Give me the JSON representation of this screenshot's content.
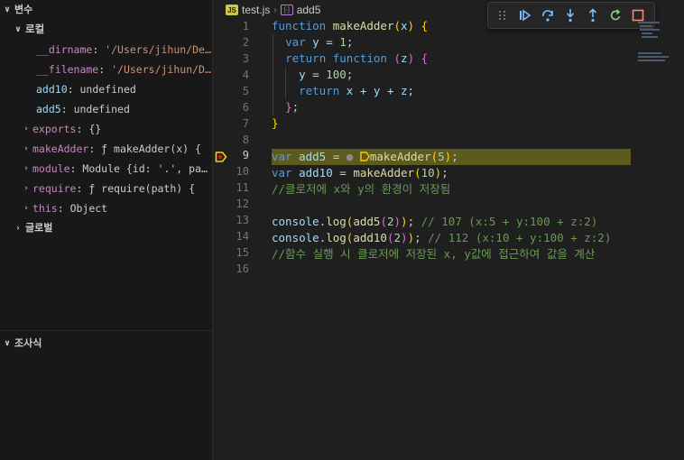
{
  "sidebar": {
    "variables_title": "변수",
    "local_title": "로컬",
    "global_title": "글로벌",
    "watch_title": "조사식",
    "vars": [
      {
        "name": "__dirname",
        "sep": ": ",
        "value": "'/Users/jihun/De…",
        "kind": "str",
        "expandable": false
      },
      {
        "name": "__filename",
        "sep": ": ",
        "value": "'/Users/jihun/D…",
        "kind": "str",
        "expandable": false
      },
      {
        "name": "add10",
        "sep": ": ",
        "value": "undefined",
        "kind": "gray",
        "expandable": false
      },
      {
        "name": "add5",
        "sep": ": ",
        "value": "undefined",
        "kind": "gray",
        "expandable": false
      },
      {
        "name": "exports",
        "sep": ": ",
        "value": "{}",
        "kind": "gray",
        "expandable": true
      },
      {
        "name": "makeAdder",
        "sep": ": ",
        "value": "ƒ makeAdder(x) {",
        "kind": "gray",
        "expandable": true
      },
      {
        "name": "module",
        "sep": ": ",
        "value": "Module {id: '.', pa…",
        "kind": "gray",
        "expandable": true
      },
      {
        "name": "require",
        "sep": ": ",
        "value": "ƒ require(path) {",
        "kind": "gray",
        "expandable": true
      },
      {
        "name": "this",
        "sep": ": ",
        "value": "Object",
        "kind": "gray",
        "expandable": true
      }
    ]
  },
  "breadcrumb": {
    "file": "test.js",
    "symbol": "add5",
    "badge": "JS"
  },
  "editor": {
    "current_line": 9,
    "lines": [
      {
        "n": "1"
      },
      {
        "n": "2"
      },
      {
        "n": "3"
      },
      {
        "n": "4"
      },
      {
        "n": "5"
      },
      {
        "n": "6"
      },
      {
        "n": "7"
      },
      {
        "n": "8"
      },
      {
        "n": "9"
      },
      {
        "n": "10"
      },
      {
        "n": "11"
      },
      {
        "n": "12"
      },
      {
        "n": "13"
      },
      {
        "n": "14"
      },
      {
        "n": "15"
      },
      {
        "n": "16"
      }
    ],
    "tokens": {
      "l1_kw": "function",
      "l1_fn": "makeAdder",
      "l1_rest": "x",
      "l2": "  var y = 1;",
      "l3_kw1": "return",
      "l3_kw2": "function",
      "l3_p": "z",
      "l4_var": "y",
      "l4_val": "100",
      "l5_kw": "return",
      "l5_expr": "x + y + z;",
      "l6": "};",
      "l7": "}",
      "l9_kw": "var",
      "l9_name": "add5",
      "l9_fn": "makeAdder",
      "l9_num": "5",
      "l10_kw": "var",
      "l10_name": "add10",
      "l10_fn": "makeAdder",
      "l10_num": "10",
      "l11": "//클로저에 x와 y의 환경이 저장됨",
      "l13_obj": "console",
      "l13_fn": "log",
      "l13_a": "add5",
      "l13_num": "2",
      "l13_comment": "// 107 (x:5 + y:100 + z:2)",
      "l14_obj": "console",
      "l14_fn": "log",
      "l14_a": "add10",
      "l14_num": "2",
      "l14_comment": "// 112 (x:10 + y:100 + z:2)",
      "l15": "//함수 실행 시 클로저에 저장된 x, y값에 접근하여 값을 계산"
    }
  },
  "colors": {
    "highlight": "#5c5a1c",
    "breakpoint_arrow": "#ffcc00",
    "continue": "#75beff",
    "restart": "#89d185",
    "stop": "#f48771"
  }
}
